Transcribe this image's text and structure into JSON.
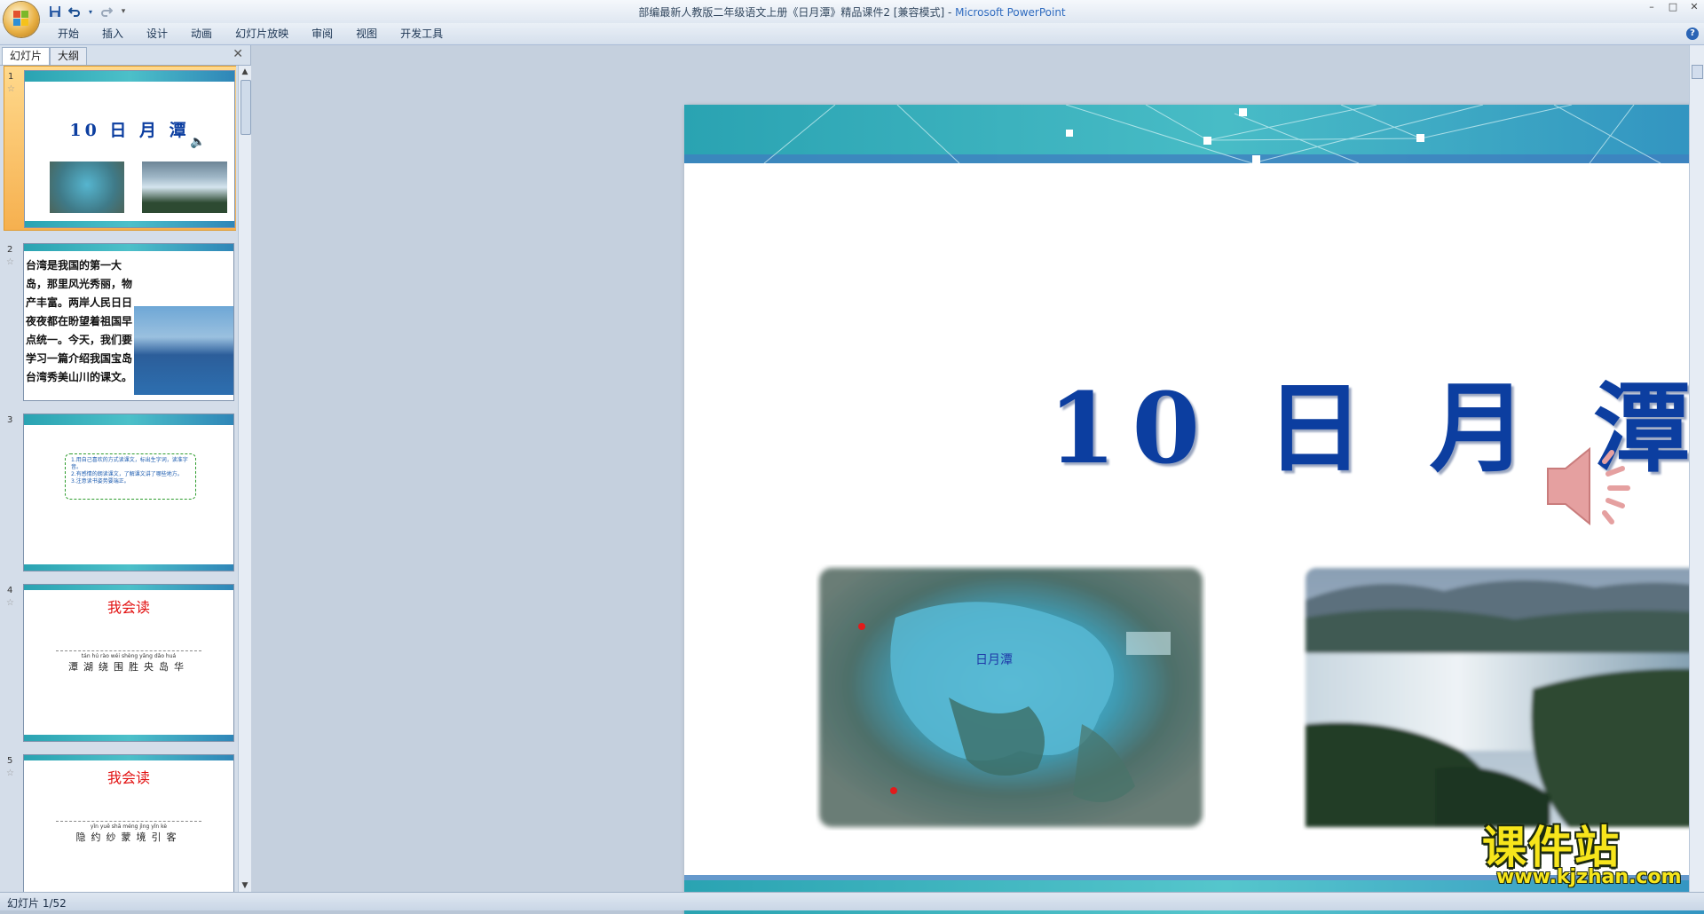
{
  "window": {
    "title_doc": "部编最新人教版二年级语文上册《日月潭》精品课件2 [兼容模式]",
    "title_sep": " - ",
    "title_app": "Microsoft PowerPoint",
    "controls": [
      "–",
      "□",
      "✕"
    ]
  },
  "qat": {
    "save": "save-icon",
    "undo": "undo-icon",
    "redo": "redo-icon"
  },
  "ribbon": {
    "tabs": [
      "开始",
      "插入",
      "设计",
      "动画",
      "幻灯片放映",
      "审阅",
      "视图",
      "开发工具"
    ],
    "help": "?"
  },
  "pane": {
    "tabs": [
      "幻灯片",
      "大纲"
    ],
    "close": "✕"
  },
  "thumbnails": [
    {
      "num": "1",
      "title": "10 日 月 潭"
    },
    {
      "num": "2",
      "text": "台湾是我国的第一大岛，那里风光秀丽，物产丰富。两岸人民日日夜夜都在盼望着祖国早点统一。今天，我们要学习一篇介绍我国宝岛台湾秀美山川的课文。"
    },
    {
      "num": "3",
      "lines": [
        "1.用自己喜欢的方式读课文，标出生字词，读准字音。",
        "2.有感情的朗读课文，了解课文讲了哪些地方。",
        "3.注意读书姿势要端正。"
      ]
    },
    {
      "num": "4",
      "heading": "我会读",
      "pinyin": "tán hú rào wéi shèng yāng dǎo huá",
      "chars": "潭湖绕围胜央岛华"
    },
    {
      "num": "5",
      "heading": "我会读",
      "pinyin": "yǐn yuē shā méng jìng yǐn kè",
      "chars": "隐约纱蒙境引客"
    }
  ],
  "slide": {
    "title": "10 日 月 潭"
  },
  "watermark": {
    "cn": "课件站",
    "url": "www.kjzhan.com"
  },
  "status": {
    "text": "幻灯片 1/52"
  },
  "colors": {
    "title_blue": "#0c3ea0",
    "band_teal": "#3bb4c4",
    "selection_orange": "#f6b04f"
  }
}
